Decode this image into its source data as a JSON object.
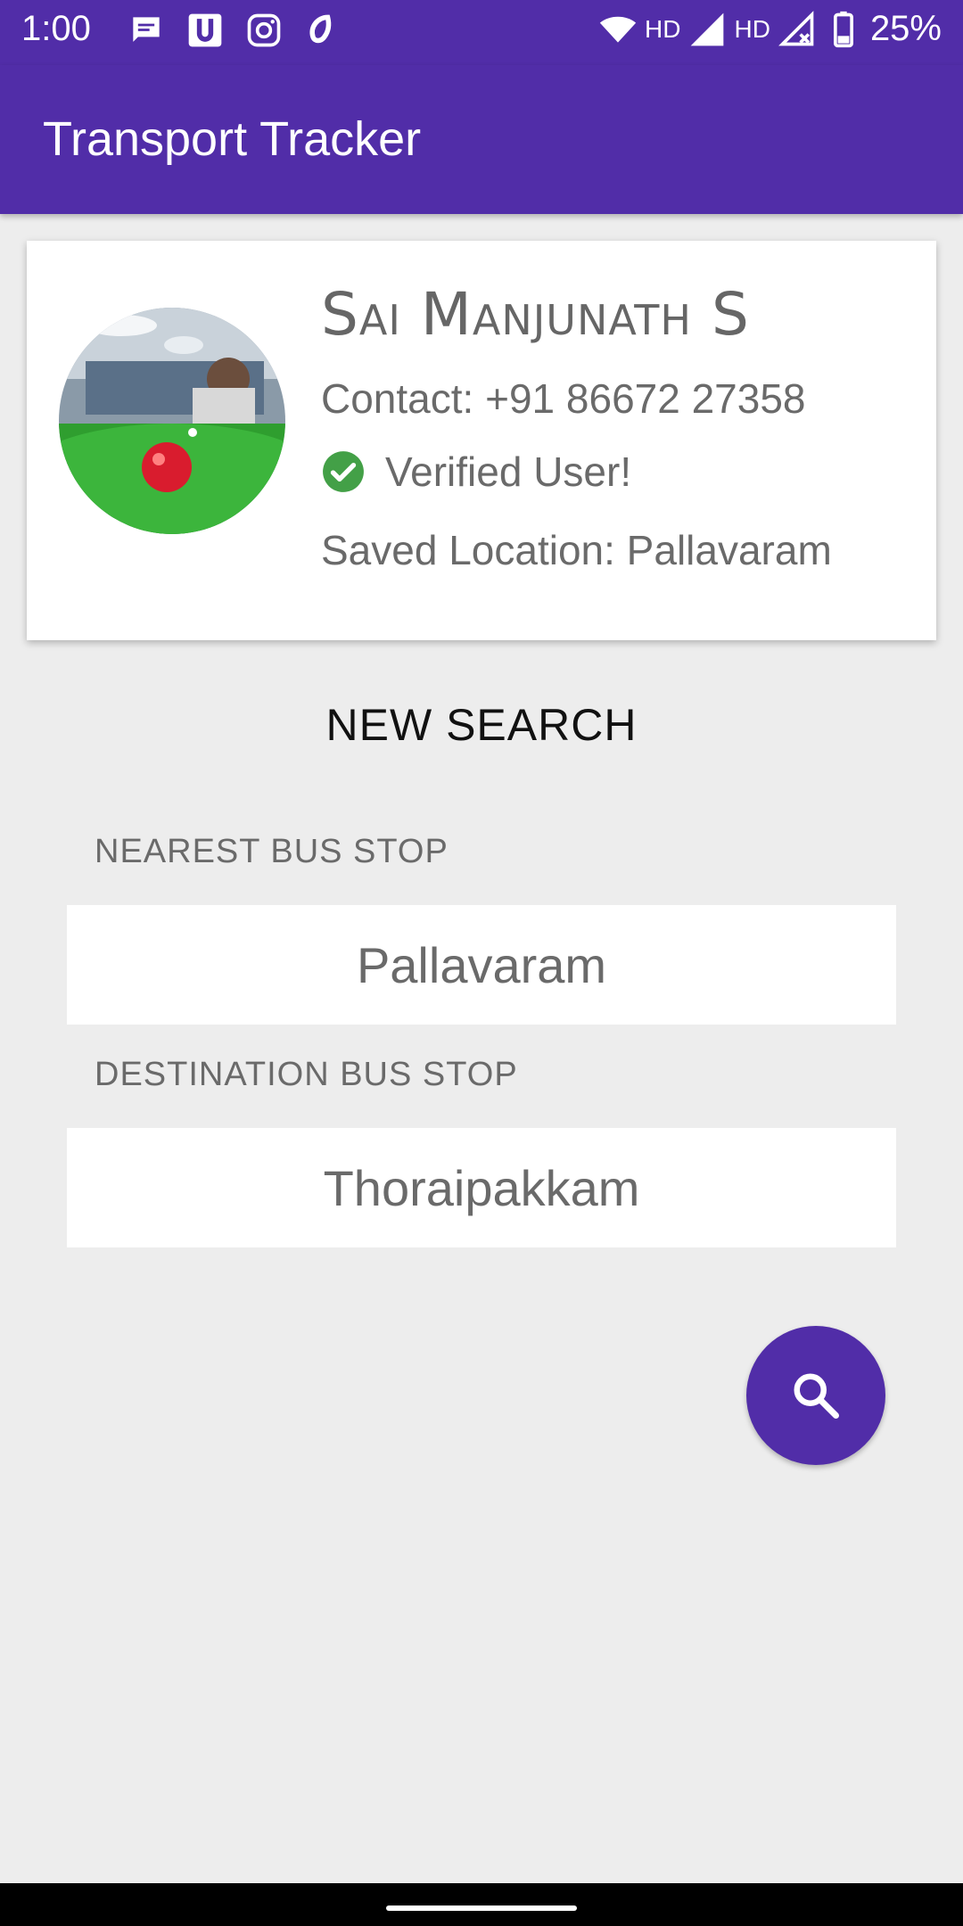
{
  "status_bar": {
    "time": "1:00",
    "notif_icons": [
      "messages-icon",
      "u-app-icon",
      "instagram-icon",
      "airtel-icon"
    ],
    "network_label_1": "HD",
    "network_label_2": "HD",
    "battery": "25%"
  },
  "app_bar": {
    "title": "Transport Tracker"
  },
  "profile": {
    "name": "Sai Manjunath S",
    "contact": "Contact: +91 86672 27358",
    "verified": "Verified User!",
    "saved_location": "Saved Location: Pallavaram"
  },
  "search": {
    "title": "NEW SEARCH",
    "nearest_label": "NEAREST BUS STOP",
    "nearest_value": "Pallavaram",
    "destination_label": "DESTINATION BUS STOP",
    "destination_value": "Thoraipakkam"
  },
  "colors": {
    "primary": "#512da8",
    "background": "#ededed",
    "verified": "#43a047"
  }
}
